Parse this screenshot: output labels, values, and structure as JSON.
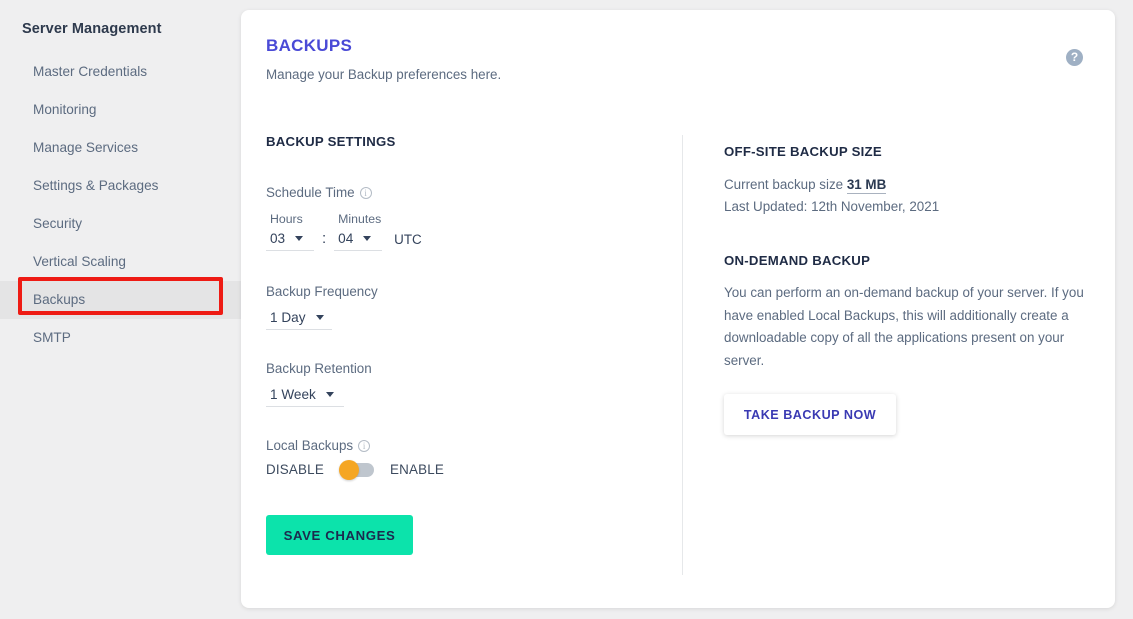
{
  "sidebar": {
    "title": "Server Management",
    "items": [
      {
        "label": "Master Credentials",
        "active": false
      },
      {
        "label": "Monitoring",
        "active": false
      },
      {
        "label": "Manage Services",
        "active": false
      },
      {
        "label": "Settings & Packages",
        "active": false
      },
      {
        "label": "Security",
        "active": false
      },
      {
        "label": "Vertical Scaling",
        "active": false
      },
      {
        "label": "Backups",
        "active": true
      },
      {
        "label": "SMTP",
        "active": false
      }
    ],
    "highlight_color": "#ee1b14"
  },
  "header": {
    "title": "BACKUPS",
    "subtitle": "Manage your Backup preferences here.",
    "title_color": "#4a4ad6",
    "help_icon": "help-circle-icon",
    "help_icon_glyph": "?"
  },
  "backup_settings": {
    "heading": "BACKUP SETTINGS",
    "schedule_time": {
      "label": "Schedule Time",
      "info_icon": "info-circle-icon",
      "info_glyph": "i",
      "hours_label": "Hours",
      "hours_value": "03",
      "minutes_label": "Minutes",
      "minutes_value": "04",
      "separator": ":",
      "timezone": "UTC"
    },
    "backup_frequency": {
      "label": "Backup Frequency",
      "value": "1 Day"
    },
    "backup_retention": {
      "label": "Backup Retention",
      "value": "1 Week"
    },
    "local_backups": {
      "label": "Local Backups",
      "info_icon": "info-circle-icon",
      "info_glyph": "i",
      "off_label": "DISABLE",
      "on_label": "ENABLE",
      "state": "disabled",
      "knob_color": "#f5a623",
      "track_color": "#bfc6ce"
    },
    "save_label": "SAVE CHANGES",
    "save_color": "#0ce3ab"
  },
  "offsite_backup": {
    "heading": "OFF-SITE BACKUP SIZE",
    "current_size_prefix": "Current backup size ",
    "current_size_value": "31 MB",
    "last_updated": "Last Updated: 12th November, 2021"
  },
  "on_demand_backup": {
    "heading": "ON-DEMAND BACKUP",
    "description": "You can perform an on-demand backup of your server. If you have enabled Local Backups, this will additionally create a downloadable copy of all the applications present on your server.",
    "button_label": "TAKE BACKUP NOW"
  }
}
